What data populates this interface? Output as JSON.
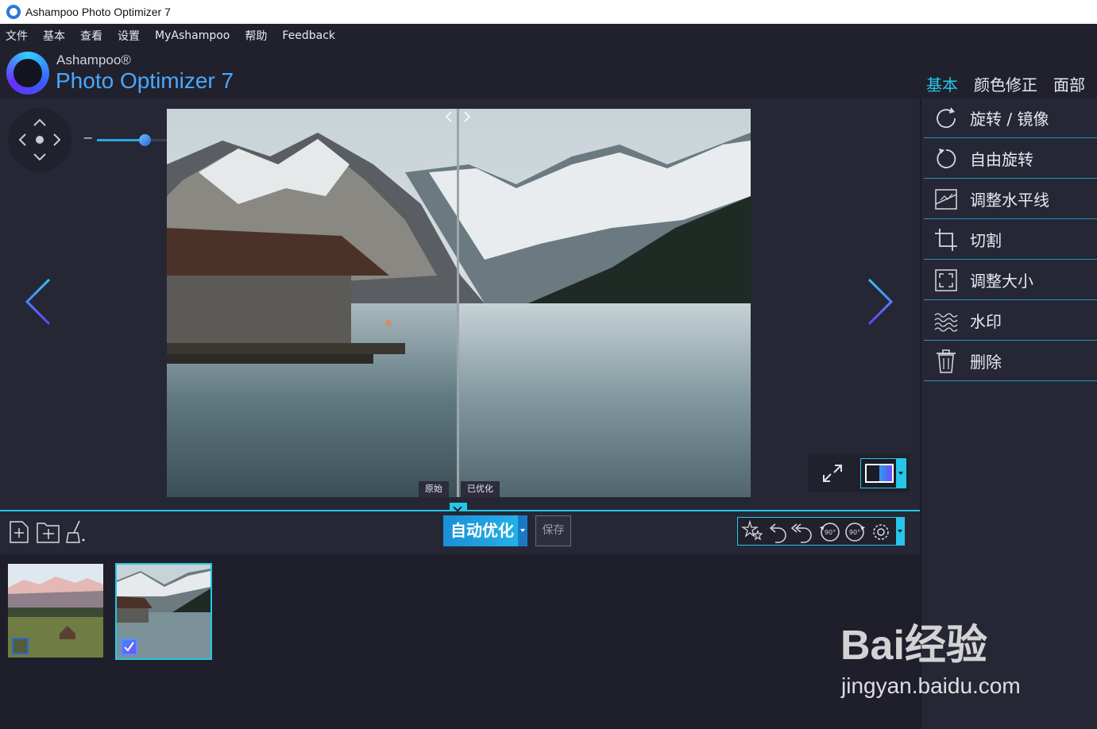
{
  "window": {
    "title": "Ashampoo Photo Optimizer 7"
  },
  "menu": [
    "文件",
    "基本",
    "查看",
    "设置",
    "MyAshampoo",
    "帮助",
    "Feedback"
  ],
  "logo": {
    "brand": "Ashampoo®",
    "product": "Photo Optimizer 7"
  },
  "tabs": [
    {
      "label": "基本",
      "active": true
    },
    {
      "label": "颜色修正",
      "active": false
    },
    {
      "label": "面部",
      "active": false
    }
  ],
  "zoom": {
    "minus": "−",
    "plus": "+",
    "value": 0.5
  },
  "compare": {
    "original_label": "原始",
    "optimized_label": "已优化"
  },
  "toolbar": {
    "auto_optimize": "自动优化",
    "save": "保存"
  },
  "right_panel": [
    {
      "label": "旋转 / 镜像",
      "icon": "rotate-icon"
    },
    {
      "label": "自由旋转",
      "icon": "free-rotate-icon"
    },
    {
      "label": "调整水平线",
      "icon": "horizon-icon"
    },
    {
      "label": "切割",
      "icon": "crop-icon"
    },
    {
      "label": "调整大小",
      "icon": "resize-icon"
    },
    {
      "label": "水印",
      "icon": "watermark-icon"
    },
    {
      "label": "删除",
      "icon": "trash-icon"
    }
  ],
  "filmstrip": [
    {
      "name": "alpine-meadow",
      "selected": false
    },
    {
      "name": "lake-boathouse",
      "selected": true
    }
  ],
  "watermark": {
    "big": "Bai经验",
    "small": "jingyan.baidu.com"
  },
  "colors": {
    "accent": "#26c6e8",
    "blue": "#1e9fe0",
    "bg": "#1e1f2b",
    "panel": "#262735"
  }
}
